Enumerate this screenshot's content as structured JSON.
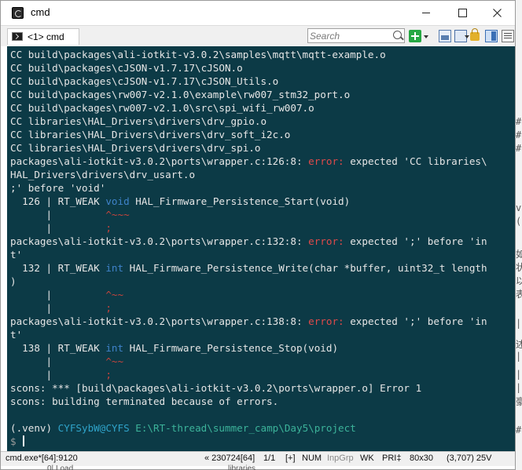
{
  "window": {
    "title": "cmd"
  },
  "toolbar": {
    "tab_label": "<1> cmd",
    "search_placeholder": "Search"
  },
  "terminal": {
    "lines": [
      [
        {
          "t": "CC build\\packages\\ali-iotkit-v3.0.2\\samples\\mqtt\\mqtt-example.o"
        }
      ],
      [
        {
          "t": "CC build\\packages\\cJSON-v1.7.17\\cJSON.o"
        }
      ],
      [
        {
          "t": "CC build\\packages\\cJSON-v1.7.17\\cJSON_Utils.o"
        }
      ],
      [
        {
          "t": "CC build\\packages\\rw007-v2.1.0\\example\\rw007_stm32_port.o"
        }
      ],
      [
        {
          "t": "CC build\\packages\\rw007-v2.1.0\\src\\spi_wifi_rw007.o"
        }
      ],
      [
        {
          "t": "CC libraries\\HAL_Drivers\\drivers\\drv_gpio.o"
        }
      ],
      [
        {
          "t": "CC libraries\\HAL_Drivers\\drivers\\drv_soft_i2c.o"
        }
      ],
      [
        {
          "t": "CC libraries\\HAL_Drivers\\drivers\\drv_spi.o"
        }
      ],
      [
        {
          "t": "packages\\ali-iotkit-v3.0.2\\ports\\wrapper.c:126:8: "
        },
        {
          "t": "error:",
          "c": "err"
        },
        {
          "t": " expected 'CC libraries\\"
        }
      ],
      [
        {
          "t": "HAL_Drivers\\drivers\\drv_usart.o"
        }
      ],
      [
        {
          "t": ";' before 'void'"
        }
      ],
      [
        {
          "t": "  126 | RT_WEAK "
        },
        {
          "t": "void",
          "c": "kw"
        },
        {
          "t": " HAL_Firmware_Persistence_Start(void)"
        }
      ],
      [
        {
          "t": "      |         "
        },
        {
          "t": "^~~~",
          "c": "caret"
        }
      ],
      [
        {
          "t": "      |         "
        },
        {
          "t": ";",
          "c": "caret"
        }
      ],
      [
        {
          "t": "packages\\ali-iotkit-v3.0.2\\ports\\wrapper.c:132:8: "
        },
        {
          "t": "error:",
          "c": "err"
        },
        {
          "t": " expected ';' before 'in"
        }
      ],
      [
        {
          "t": "t'"
        }
      ],
      [
        {
          "t": "  132 | RT_WEAK "
        },
        {
          "t": "int",
          "c": "kw"
        },
        {
          "t": " HAL_Firmware_Persistence_Write(char *buffer, uint32_t length"
        }
      ],
      [
        {
          "t": ")"
        }
      ],
      [
        {
          "t": "      |         "
        },
        {
          "t": "^~~",
          "c": "caret"
        }
      ],
      [
        {
          "t": "      |         "
        },
        {
          "t": ";",
          "c": "caret"
        }
      ],
      [
        {
          "t": "packages\\ali-iotkit-v3.0.2\\ports\\wrapper.c:138:8: "
        },
        {
          "t": "error:",
          "c": "err"
        },
        {
          "t": " expected ';' before 'in"
        }
      ],
      [
        {
          "t": "t'"
        }
      ],
      [
        {
          "t": "  138 | RT_WEAK "
        },
        {
          "t": "int",
          "c": "kw"
        },
        {
          "t": " HAL_Firmware_Persistence_Stop(void)"
        }
      ],
      [
        {
          "t": "      |         "
        },
        {
          "t": "^~~",
          "c": "caret"
        }
      ],
      [
        {
          "t": "      |         "
        },
        {
          "t": ";",
          "c": "caret"
        }
      ],
      [
        {
          "t": "scons: *** [build\\packages\\ali-iotkit-v3.0.2\\ports\\wrapper.o] Error 1"
        }
      ],
      [
        {
          "t": "scons: building terminated because of errors."
        }
      ],
      [
        {
          "t": ""
        }
      ],
      [
        {
          "t": "(.venv) "
        },
        {
          "t": "CYFSybW@CYFS",
          "c": "userhost"
        },
        {
          "t": " "
        },
        {
          "t": "E:\\RT-thread\\summer_camp\\Day5\\project",
          "c": "path"
        }
      ],
      [
        {
          "t": "$ ",
          "c": "dollar"
        }
      ]
    ]
  },
  "statusbar": {
    "process": "cmd.exe*[64]:9120",
    "position": "« 230724[64]",
    "pages": "1/1",
    "plus": "[+]",
    "num": "NUM",
    "inpgrp": "InpGrp",
    "wk": "WK",
    "pri": "PRI‡",
    "size": "80x30",
    "cursor": "(3,707) 25V"
  },
  "background": {
    "right_fragments": [
      "#",
      "#",
      "#",
      "v",
      "(",
      "如",
      "状",
      "以",
      "表",
      "|",
      "述",
      "|",
      "|",
      "|",
      "豪",
      "#"
    ],
    "below_left": "0| Load",
    "below_right": "libraries"
  }
}
